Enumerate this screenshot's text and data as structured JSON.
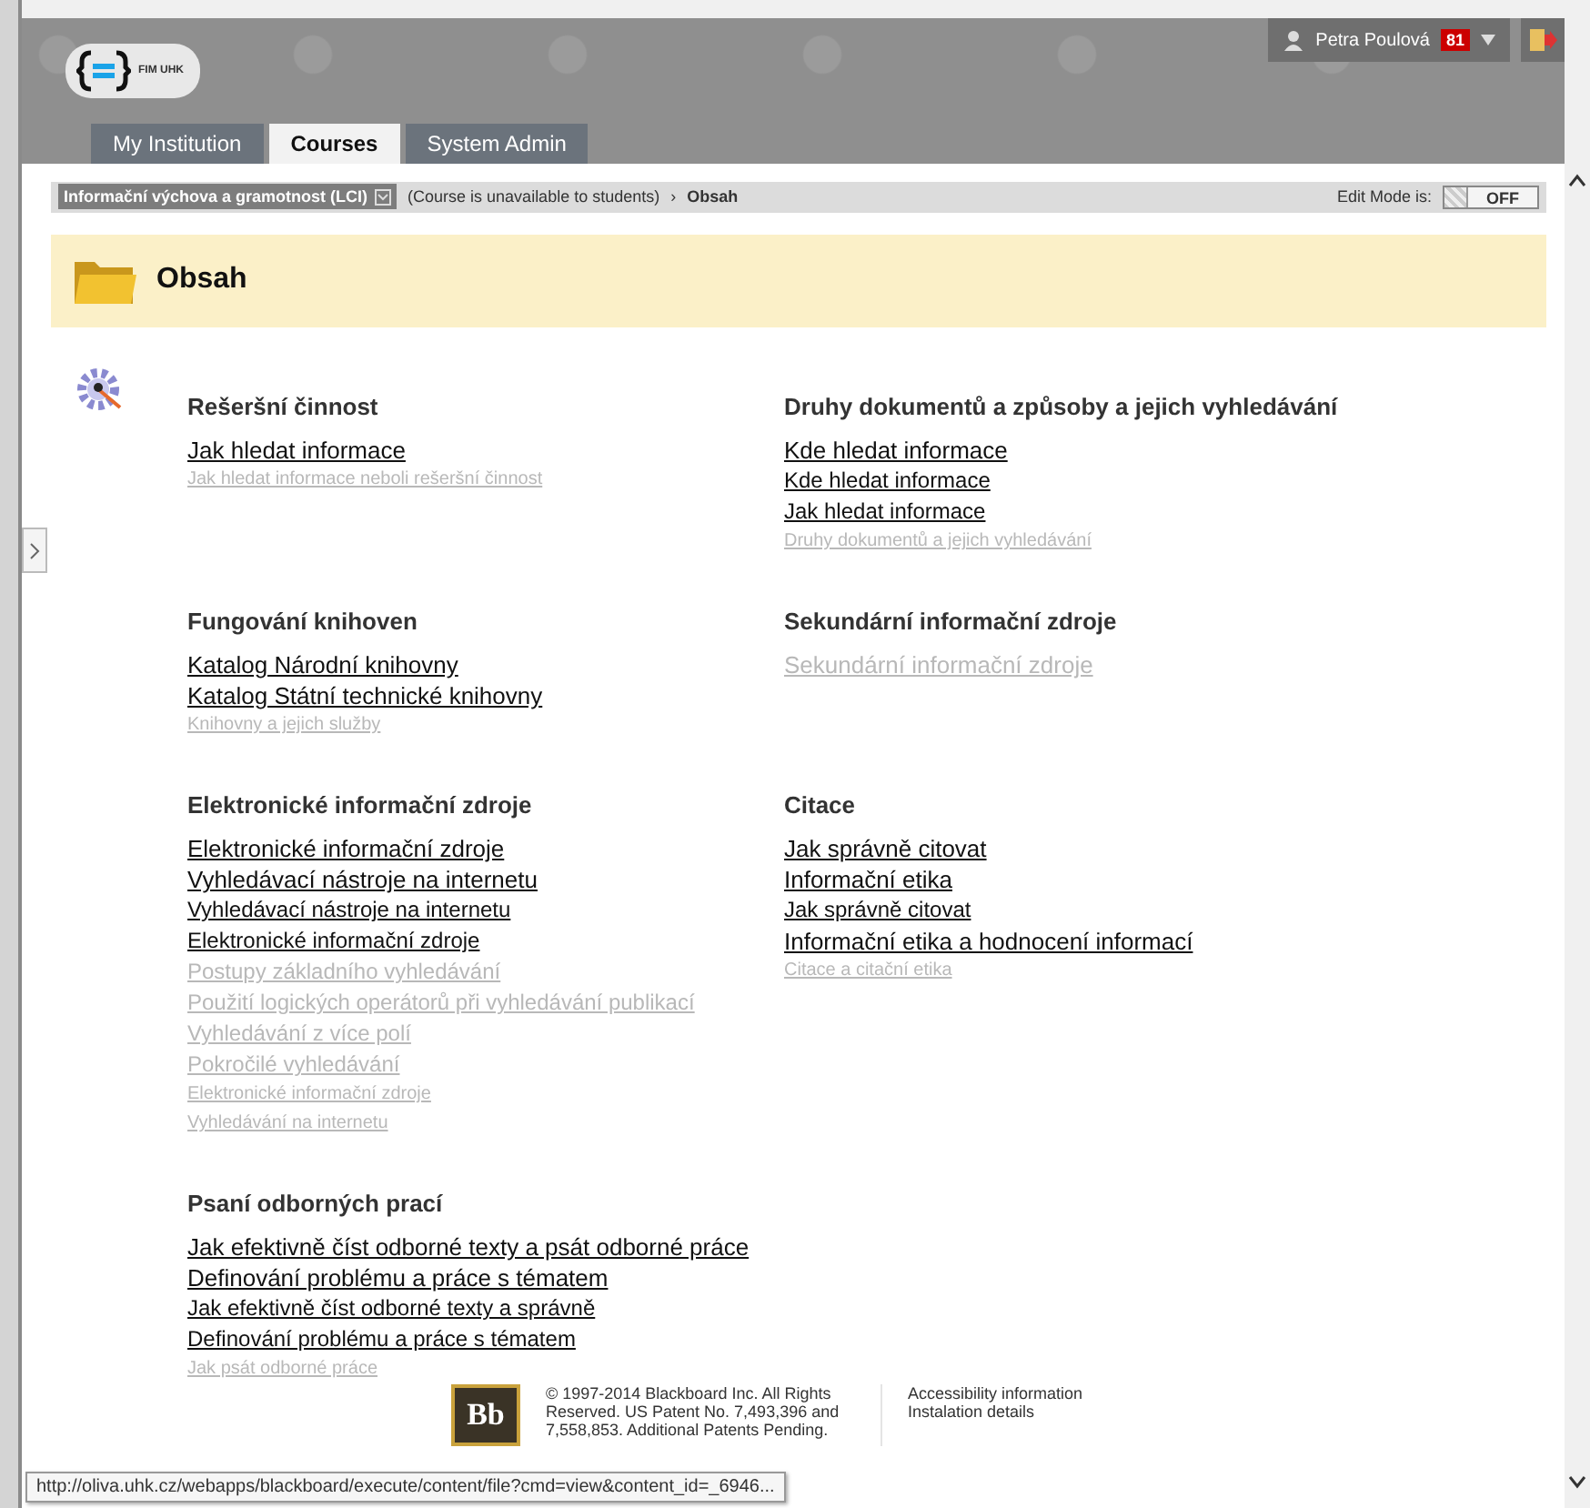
{
  "header": {
    "logo_text": "FIM UHK",
    "user_name": "Petra Poulová",
    "notification_count": "81",
    "tabs": [
      {
        "label": "My Institution",
        "selected": false
      },
      {
        "label": "Courses",
        "selected": true
      },
      {
        "label": "System Admin",
        "selected": false
      }
    ]
  },
  "breadcrumb": {
    "course": "Informační výchova a gramotnost (LCI)",
    "status": "(Course is unavailable to students)",
    "separator": "›",
    "current": "Obsah",
    "edit_mode_label": "Edit Mode is:",
    "edit_mode": {
      "label": "OFF",
      "on": false
    }
  },
  "page_title": "Obsah",
  "sections": [
    {
      "title": "Rešeršní činnost",
      "links": [
        {
          "text": "Jak hledat informace",
          "kind": "large",
          "available": true
        },
        {
          "text": "Jak hledat informace neboli rešeršní činnost",
          "kind": "small",
          "available": false
        }
      ]
    },
    {
      "title": "Druhy dokumentů a způsoby a jejich vyhledávání",
      "links": [
        {
          "text": "Kde hledat informace",
          "kind": "large",
          "available": true
        },
        {
          "text": "Kde hledat informace",
          "kind": "medium",
          "available": true
        },
        {
          "text": "Jak hledat informace",
          "kind": "medium",
          "available": true
        },
        {
          "text": "Druhy dokumentů a jejich vyhledávání",
          "kind": "small",
          "available": false
        }
      ]
    },
    {
      "title": "Fungování knihoven",
      "links": [
        {
          "text": "Katalog Národní knihovny",
          "kind": "large",
          "available": true
        },
        {
          "text": "Katalog Státní technické knihovny",
          "kind": "large",
          "available": true
        },
        {
          "text": "Knihovny a jejich služby",
          "kind": "small",
          "available": false
        }
      ]
    },
    {
      "title": "Sekundární informační zdroje",
      "links": [
        {
          "text": "Sekundární informační zdroje",
          "kind": "large",
          "available": false
        }
      ]
    },
    {
      "title": "Elektronické informační zdroje",
      "links": [
        {
          "text": "Elektronické informační zdroje",
          "kind": "large",
          "available": true
        },
        {
          "text": "Vyhledávací nástroje na internetu",
          "kind": "large",
          "available": true
        },
        {
          "text": "Vyhledávací nástroje na internetu",
          "kind": "medium",
          "available": true
        },
        {
          "text": "Elektronické informační zdroje",
          "kind": "medium",
          "available": true
        },
        {
          "text": "Postupy základního vyhledávání",
          "kind": "medium",
          "available": false
        },
        {
          "text": "Použití logických operátorů při vyhledávání publikací",
          "kind": "medium",
          "available": false
        },
        {
          "text": "Vyhledávání z více polí",
          "kind": "medium",
          "available": false
        },
        {
          "text": "Pokročilé vyhledávání",
          "kind": "medium",
          "available": false
        },
        {
          "text": "Elektronické informační zdroje",
          "kind": "small",
          "available": false
        },
        {
          "text": "Vyhledávání na internetu",
          "kind": "small",
          "available": false
        }
      ]
    },
    {
      "title": "Citace",
      "links": [
        {
          "text": "Jak správně citovat",
          "kind": "large",
          "available": true
        },
        {
          "text": "Informační etika",
          "kind": "large",
          "available": true
        },
        {
          "text": "Jak správně citovat",
          "kind": "medium",
          "available": true
        },
        {
          "text": "Informační etika a hodnocení informací",
          "kind": "large",
          "available": true
        },
        {
          "text": "Citace a citační etika",
          "kind": "small",
          "available": false
        }
      ]
    },
    {
      "title": "Psaní odborných prací",
      "links": [
        {
          "text": "Jak efektivně číst odborné texty a psát odborné práce",
          "kind": "large",
          "available": true
        },
        {
          "text": "Definování problému a práce s tématem",
          "kind": "large",
          "available": true
        },
        {
          "text": "Jak efektivně číst odborné texty a správně",
          "kind": "medium",
          "available": true
        },
        {
          "text": "Definování problému a práce s tématem",
          "kind": "medium",
          "available": true
        },
        {
          "text": "Jak psát odborné práce",
          "kind": "small",
          "available": false
        }
      ]
    }
  ],
  "footer": {
    "logo_text": "Bb",
    "copyright": "© 1997-2014 Blackboard Inc. All Rights Reserved. US Patent No. 7,493,396 and 7,558,853. Additional Patents Pending.",
    "links": [
      "Accessibility information",
      "Instalation details"
    ]
  },
  "status_url": "http://oliva.uhk.cz/webapps/blackboard/execute/content/file?cmd=view&content_id=_6946..."
}
